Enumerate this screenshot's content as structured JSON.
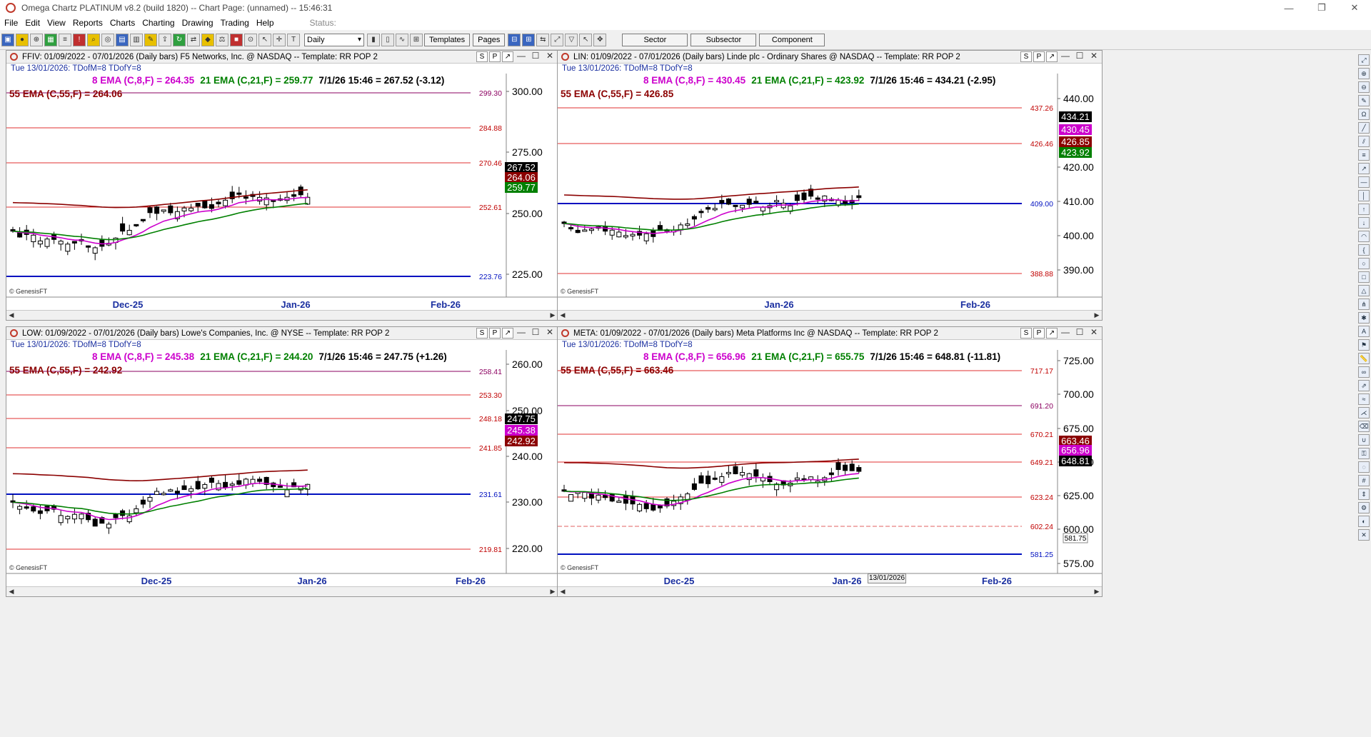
{
  "window": {
    "title": "Omega Chartz PLATINUM v8.2 (build 1820)  --  Chart Page: (unnamed)  --  15:46:31",
    "controls": [
      "—",
      "❐",
      "✕"
    ]
  },
  "menu": {
    "items": [
      "File",
      "Edit",
      "View",
      "Reports",
      "Charts",
      "Charting",
      "Drawing",
      "Trading",
      "Help"
    ],
    "status_label": "Status:"
  },
  "toolbar": {
    "period_select": "Daily",
    "templates_label": "Templates",
    "pages_label": "Pages",
    "sector_label": "Sector",
    "subsector_label": "Subsector",
    "component_label": "Component"
  },
  "panel_buttons": [
    "S",
    "P",
    "↗",
    "—",
    "☐",
    "✕"
  ],
  "watermark": "© GenesisFT",
  "date_tip": "13/01/2026",
  "colors": {
    "ema8": "#cc00cc",
    "ema21": "#008000",
    "ema55": "#8b0000",
    "level_red": "#e03030",
    "level_blue": "#0010c0",
    "sub_text": "#1a2fa0"
  },
  "panels": [
    {
      "title": "FFIV:  01/09/2022 - 07/01/2026  (Daily bars)   F5 Networks, Inc. @ NASDAQ  --  Template: RR POP 2",
      "sub": "Tue    13/01/2026:   TDofM=8   TDofY=8",
      "legend_line1": {
        "ema8": "8 EMA (C,8,F) = 264.35",
        "ema21": "21 EMA (C,21,F) = 259.77",
        "quote": "7/1/26 15:46 = 267.52 (-3.12)"
      },
      "legend_line2": "55 EMA (C,55,F) = 264.06",
      "y_ticks": [
        "300.00",
        "275.00",
        "250.00",
        "225.00"
      ],
      "x_labels": [
        "Dec-25",
        "Jan-26",
        "Feb-26"
      ],
      "levels": [
        {
          "label": "299.30",
          "kind": "purple"
        },
        {
          "label": "284.88",
          "kind": "red"
        },
        {
          "label": "270.46",
          "kind": "red"
        },
        {
          "label": "252.61",
          "kind": "red"
        },
        {
          "label": "223.76",
          "kind": "blue"
        }
      ],
      "tags": [
        {
          "label": "267.52",
          "kind": "price"
        },
        {
          "label": "264.06",
          "kind": "ema55"
        },
        {
          "label": "259.77",
          "kind": "ema21"
        }
      ]
    },
    {
      "title": "LIN:  01/09/2022 - 07/01/2026  (Daily bars)   Linde plc - Ordinary Shares @ NASDAQ  --  Template: RR POP 2",
      "sub": "Tue    13/01/2026:   TDofM=8   TDofY=8",
      "legend_line1": {
        "ema8": "8 EMA (C,8,F) = 430.45",
        "ema21": "21 EMA (C,21,F) = 423.92",
        "quote": "7/1/26 15:46 = 434.21 (-2.95)"
      },
      "legend_line2": "55 EMA (C,55,F) = 426.85",
      "y_ticks": [
        "440.00",
        "420.00",
        "410.00",
        "400.00",
        "390.00"
      ],
      "x_labels": [
        "Jan-26",
        "Feb-26"
      ],
      "levels": [
        {
          "label": "437.26",
          "kind": "red"
        },
        {
          "label": "426.46",
          "kind": "red"
        },
        {
          "label": "409.00",
          "kind": "blue"
        },
        {
          "label": "388.88",
          "kind": "red"
        }
      ],
      "tags": [
        {
          "label": "434.21",
          "kind": "price"
        },
        {
          "label": "430.45",
          "kind": "ema8"
        },
        {
          "label": "426.85",
          "kind": "ema55"
        },
        {
          "label": "423.92",
          "kind": "ema21"
        }
      ]
    },
    {
      "title": "LOW:  01/09/2022 - 07/01/2026  (Daily bars)   Lowe's Companies, Inc. @ NYSE  --  Template: RR POP 2",
      "sub": "Tue    13/01/2026:   TDofM=8   TDofY=8",
      "legend_line1": {
        "ema8": "8 EMA (C,8,F) = 245.38",
        "ema21": "21 EMA (C,21,F) = 244.20",
        "quote": "7/1/26 15:46 = 247.75 (+1.26)"
      },
      "legend_line2": "55 EMA (C,55,F) = 242.92",
      "y_ticks": [
        "260.00",
        "250.00",
        "240.00",
        "230.00",
        "220.00"
      ],
      "x_labels": [
        "Dec-25",
        "Jan-26",
        "Feb-26"
      ],
      "levels": [
        {
          "label": "258.41",
          "kind": "purple"
        },
        {
          "label": "253.30",
          "kind": "red"
        },
        {
          "label": "248.18",
          "kind": "red"
        },
        {
          "label": "241.85",
          "kind": "red"
        },
        {
          "label": "231.61",
          "kind": "blue"
        },
        {
          "label": "219.81",
          "kind": "red"
        }
      ],
      "tags": [
        {
          "label": "247.75",
          "kind": "price"
        },
        {
          "label": "245.38",
          "kind": "ema8"
        },
        {
          "label": "242.92",
          "kind": "ema55"
        }
      ]
    },
    {
      "title": "META:  01/09/2022 - 07/01/2026  (Daily bars)   Meta Platforms Inc @ NASDAQ  --  Template: RR POP 2",
      "sub": "Tue    13/01/2026:   TDofM=8   TDofY=8",
      "legend_line1": {
        "ema8": "8 EMA (C,8,F) = 656.96",
        "ema21": "21 EMA (C,21,F) = 655.75",
        "quote": "7/1/26 15:46 = 648.81 (-11.81)"
      },
      "legend_line2": "55 EMA (C,55,F) = 663.46",
      "y_ticks": [
        "725.00",
        "700.00",
        "675.00",
        "650.00",
        "625.00",
        "600.00",
        "575.00"
      ],
      "x_labels": [
        "Dec-25",
        "Jan-26",
        "Feb-26"
      ],
      "levels": [
        {
          "label": "717.17",
          "kind": "red"
        },
        {
          "label": "691.20",
          "kind": "purple"
        },
        {
          "label": "670.21",
          "kind": "red"
        },
        {
          "label": "649.21",
          "kind": "red"
        },
        {
          "label": "623.24",
          "kind": "red"
        },
        {
          "label": "602.24",
          "kind": "dash"
        },
        {
          "label": "581.25",
          "kind": "blue"
        }
      ],
      "tags": [
        {
          "label": "663.46",
          "kind": "ema55"
        },
        {
          "label": "656.96",
          "kind": "ema8"
        },
        {
          "label": "648.81",
          "kind": "price"
        }
      ],
      "extra_tag": "581.75"
    }
  ]
}
